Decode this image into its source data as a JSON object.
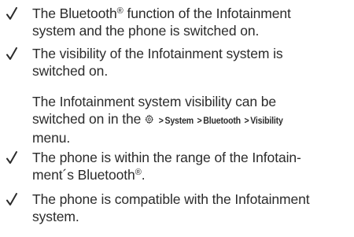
{
  "items": [
    {
      "line1": "The Bluetooth",
      "reg1": "®",
      "line1_tail": " function of the Infotainment",
      "line2": "system and the phone is switched on."
    },
    {
      "line1": "The visibility of the Infotainment system is",
      "line2": "switched on."
    },
    {
      "line1": "The phone is within the range of the Infotain-",
      "line2_pre": "ment´s Bluetooth",
      "reg2": "®",
      "line2_post": "."
    },
    {
      "line1": "The phone is compatible with the Infotainment",
      "line2": "system."
    }
  ],
  "note": {
    "line1": "The Infotainment system visibility can be",
    "line2_pre": "switched on in the",
    "path": [
      "System",
      "Bluetooth",
      "Visibility"
    ],
    "separator": ">",
    "line3": "menu."
  },
  "icons": {
    "bullet": "check-icon",
    "settings": "gear-icon"
  }
}
